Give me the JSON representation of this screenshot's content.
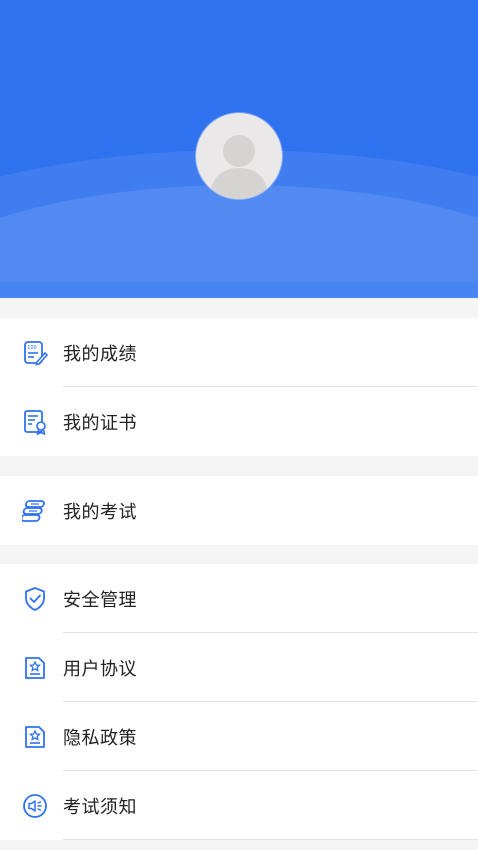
{
  "profile": {
    "avatar_icon": "user-avatar-placeholder-icon",
    "colors": {
      "header": "#2f72f0",
      "accent_icon": "#2f72f0",
      "background": "#f5f5f5"
    }
  },
  "menu_groups": [
    {
      "items": [
        {
          "label": "我的成绩",
          "icon": "score-sheet-icon"
        },
        {
          "label": "我的证书",
          "icon": "certificate-icon"
        }
      ]
    },
    {
      "items": [
        {
          "label": "我的考试",
          "icon": "exam-stack-icon"
        }
      ]
    },
    {
      "items": [
        {
          "label": "安全管理",
          "icon": "shield-check-icon"
        },
        {
          "label": "用户协议",
          "icon": "star-document-icon"
        },
        {
          "label": "隐私政策",
          "icon": "star-document-icon"
        },
        {
          "label": "考试须知",
          "icon": "speaker-notice-icon"
        }
      ]
    }
  ]
}
